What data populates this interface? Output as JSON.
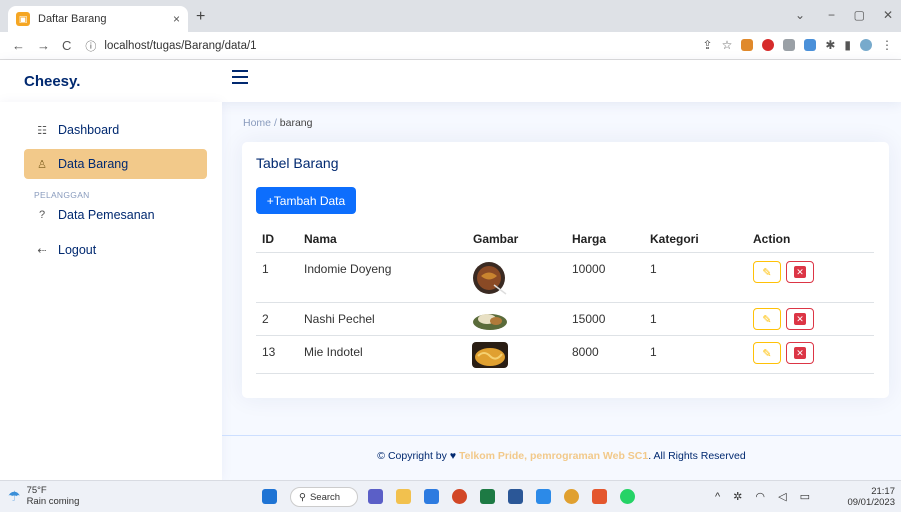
{
  "browser": {
    "tab_title": "Daftar Barang",
    "tab_close": "×",
    "new_tab": "+",
    "url": "localhost/tugas/Barang/data/1",
    "back": "←",
    "forward": "→",
    "reload": "C",
    "minimize": "−",
    "restore": "▢",
    "close": "✕",
    "chevron": "⌄"
  },
  "header": {
    "logo": "Cheesy."
  },
  "sidebar": {
    "items": [
      {
        "label": "Dashboard",
        "icon": "grid-icon"
      },
      {
        "label": "Data Barang",
        "icon": "person-icon"
      },
      {
        "label": "Data Pemesanan",
        "icon": "question-circle-icon"
      },
      {
        "label": "Logout",
        "icon": "logout-icon"
      }
    ],
    "heading": "PELANGGAN"
  },
  "breadcrumb": {
    "home": "Home",
    "separator": "/",
    "current": "barang"
  },
  "card": {
    "title": "Tabel Barang",
    "add_button": "+Tambah Data"
  },
  "table": {
    "headers": [
      "ID",
      "Nama",
      "Gambar",
      "Harga",
      "Kategori",
      "Action"
    ],
    "rows": [
      {
        "id": "1",
        "nama": "Indomie Doyeng",
        "harga": "10000",
        "kategori": "1"
      },
      {
        "id": "2",
        "nama": "Nashi Pechel",
        "harga": "15000",
        "kategori": "1"
      },
      {
        "id": "13",
        "nama": "Mie Indotel",
        "harga": "8000",
        "kategori": "1"
      }
    ],
    "edit_icon": "✎",
    "delete_icon": "✕"
  },
  "footer": {
    "prefix": "© Copyright by",
    "heart": "♥",
    "brand": "Telkom Pride, pemrograman Web SC1",
    "suffix": ". All Rights Reserved"
  },
  "taskbar": {
    "temperature": "75°F",
    "weather_text": "Rain coming",
    "search": "Search",
    "time": "21:17",
    "date": "09/01/2023"
  },
  "colors": {
    "primary": "#012970",
    "accent": "#f2c98a",
    "button": "#0d6efd",
    "danger": "#dc3545",
    "warning": "#ffc107"
  }
}
